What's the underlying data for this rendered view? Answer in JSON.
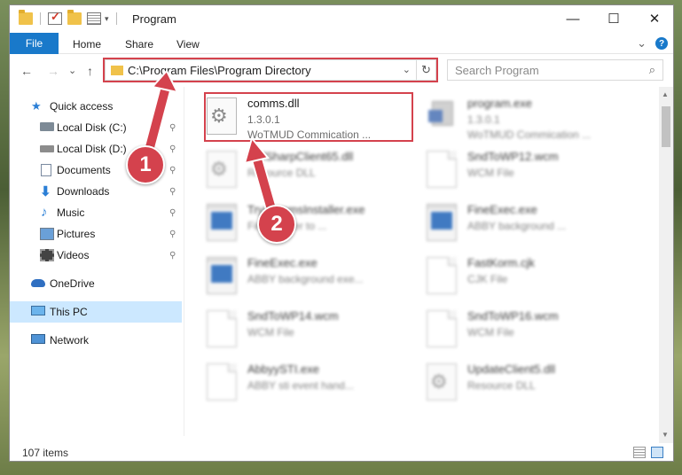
{
  "window": {
    "title": "Program",
    "minimize_glyph": "—",
    "maximize_glyph": "☐",
    "close_glyph": "✕"
  },
  "ribbon": {
    "tabs": [
      "File",
      "Home",
      "Share",
      "View"
    ],
    "expand_glyph": "⌄",
    "help_glyph": "?"
  },
  "nav": {
    "back_glyph": "←",
    "forward_glyph": "→",
    "recent_glyph": "⌄",
    "up_glyph": "↑",
    "address": "C:\\Program Files\\Program Directory",
    "address_dropdown_glyph": "⌄",
    "refresh_glyph": "↻",
    "search_placeholder": "Search Program",
    "search_glyph": "⌕"
  },
  "sidebar": {
    "items": [
      {
        "label": "Quick access",
        "icon": "star-icon",
        "pinned": false
      },
      {
        "label": "Local Disk (C:)",
        "icon": "drive-icon",
        "pinned": true
      },
      {
        "label": "Local Disk (D:)",
        "icon": "drive-icon",
        "pinned": true
      },
      {
        "label": "Documents",
        "icon": "documents-icon",
        "pinned": true
      },
      {
        "label": "Downloads",
        "icon": "download-icon",
        "pinned": true
      },
      {
        "label": "Music",
        "icon": "music-icon",
        "pinned": true
      },
      {
        "label": "Pictures",
        "icon": "pictures-icon",
        "pinned": true
      },
      {
        "label": "Videos",
        "icon": "videos-icon",
        "pinned": true
      },
      {
        "label": "OneDrive",
        "icon": "cloud-icon",
        "pinned": false
      },
      {
        "label": "This PC",
        "icon": "computer-icon",
        "pinned": false,
        "selected": true
      },
      {
        "label": "Network",
        "icon": "network-icon",
        "pinned": false
      }
    ],
    "pin_glyph": "📌"
  },
  "files": [
    {
      "name": "comms.dll",
      "line2": "1.3.0.1",
      "line3": "WoTMUD Commication ...",
      "icon": "gear-file-icon",
      "highlighted": true
    },
    {
      "name": "program.exe",
      "line2": "1.3.0.1",
      "line3": "WoTMUD Commication ...",
      "icon": "program-icon"
    },
    {
      "name": "CefSharpClient65.dll",
      "line2": "Resource DLL",
      "line3": "",
      "icon": "gear-file-icon"
    },
    {
      "name": "SndToWP12.wcm",
      "line2": "WCM File",
      "line3": "",
      "icon": "document-icon"
    },
    {
      "name": "TryCommsInstaller.exe",
      "line2": "FineReader to ...",
      "line3": "",
      "icon": "exe-icon"
    },
    {
      "name": "FineExec.exe",
      "line2": "ABBY background ...",
      "line3": "",
      "icon": "exe-icon"
    },
    {
      "name": "FineExec.exe",
      "line2": "ABBY background exe...",
      "line3": "",
      "icon": "exe-icon"
    },
    {
      "name": "FastKorm.cjk",
      "line2": "CJK File",
      "line3": "",
      "icon": "document-icon"
    },
    {
      "name": "SndToWP14.wcm",
      "line2": "WCM File",
      "line3": "",
      "icon": "document-icon"
    },
    {
      "name": "SndToWP16.wcm",
      "line2": "WCM File",
      "line3": "",
      "icon": "document-icon"
    },
    {
      "name": "AbbyySTI.exe",
      "line2": "ABBY sti event hand...",
      "line3": "",
      "icon": "document-icon"
    },
    {
      "name": "UpdateClient5.dll",
      "line2": "Resource DLL",
      "line3": "",
      "icon": "gear-file-icon"
    }
  ],
  "status": {
    "item_count": "107 items"
  },
  "annotations": {
    "callout_1": "1",
    "callout_2": "2",
    "highlight_color": "#d4424d"
  },
  "colors": {
    "accent": "#1979ca",
    "selection": "#cce8ff"
  }
}
